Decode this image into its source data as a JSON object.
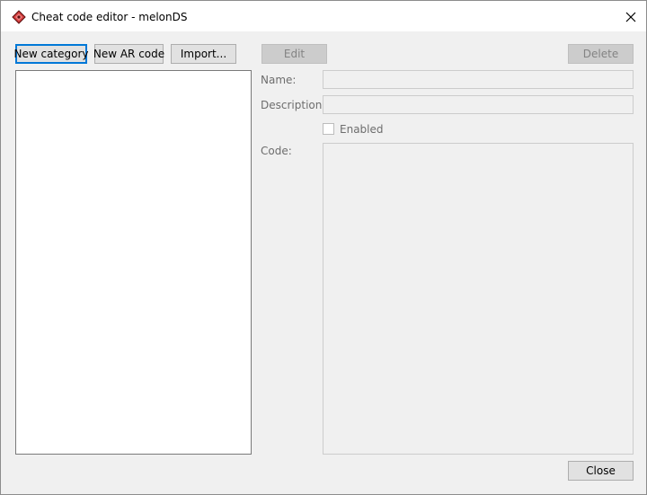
{
  "window": {
    "title": "Cheat code editor - melonDS"
  },
  "toolbar": {
    "new_category": "New category",
    "new_ar_code": "New AR code",
    "import": "Import...",
    "edit": "Edit",
    "delete": "Delete"
  },
  "form": {
    "name_label": "Name:",
    "name_value": "",
    "description_label": "Description:",
    "description_value": "",
    "enabled_label": "Enabled",
    "enabled_checked": false,
    "code_label": "Code:",
    "code_value": ""
  },
  "footer": {
    "close": "Close"
  },
  "colors": {
    "focus_border": "#0078d7",
    "disabled_text": "#838383",
    "app_icon_red": "#d23c3c"
  }
}
